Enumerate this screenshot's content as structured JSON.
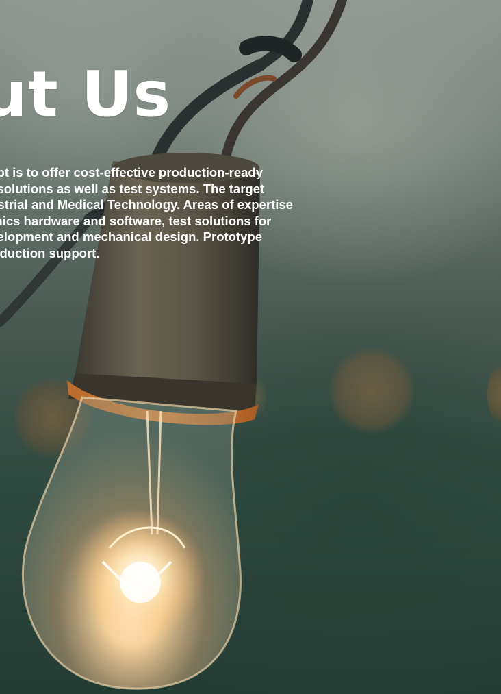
{
  "page": {
    "heading": "out Us",
    "intro_lines": [
      "concept is to offer cost-effective production-ready",
      "s and solutions as well as test systems. The target",
      "e Industrial and Medical Technology. Areas of expertise",
      "lectronics hardware and software, test solutions for",
      "ct development and mechanical design. Prototype",
      "nd production support."
    ]
  },
  "background": {
    "image_subject": "light-bulb-icon",
    "colors": {
      "text": "#ffffff",
      "backdrop_top": "#8e9690",
      "backdrop_bottom": "#223b33",
      "glow": "#ffd9a0"
    }
  }
}
